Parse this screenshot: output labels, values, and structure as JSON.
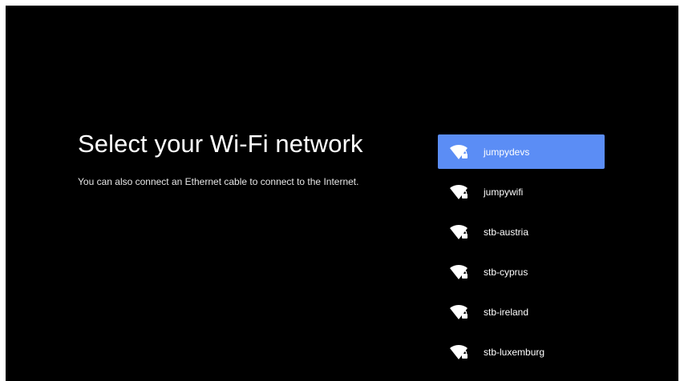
{
  "setup": {
    "title": "Select your Wi-Fi network",
    "subtitle": "You can also connect an Ethernet cable to connect to the Internet."
  },
  "networks": [
    {
      "name": "jumpydevs",
      "icon": "wifi-lock-icon",
      "selected": true
    },
    {
      "name": "jumpywifi",
      "icon": "wifi-lock-icon",
      "selected": false
    },
    {
      "name": "stb-austria",
      "icon": "wifi-lock-icon",
      "selected": false
    },
    {
      "name": "stb-cyprus",
      "icon": "wifi-lock-icon",
      "selected": false
    },
    {
      "name": "stb-ireland",
      "icon": "wifi-lock-icon",
      "selected": false
    },
    {
      "name": "stb-luxemburg",
      "icon": "wifi-lock-icon",
      "selected": false
    }
  ],
  "colors": {
    "background": "#000000",
    "selection": "#5b8df5",
    "text": "#ffffff"
  }
}
